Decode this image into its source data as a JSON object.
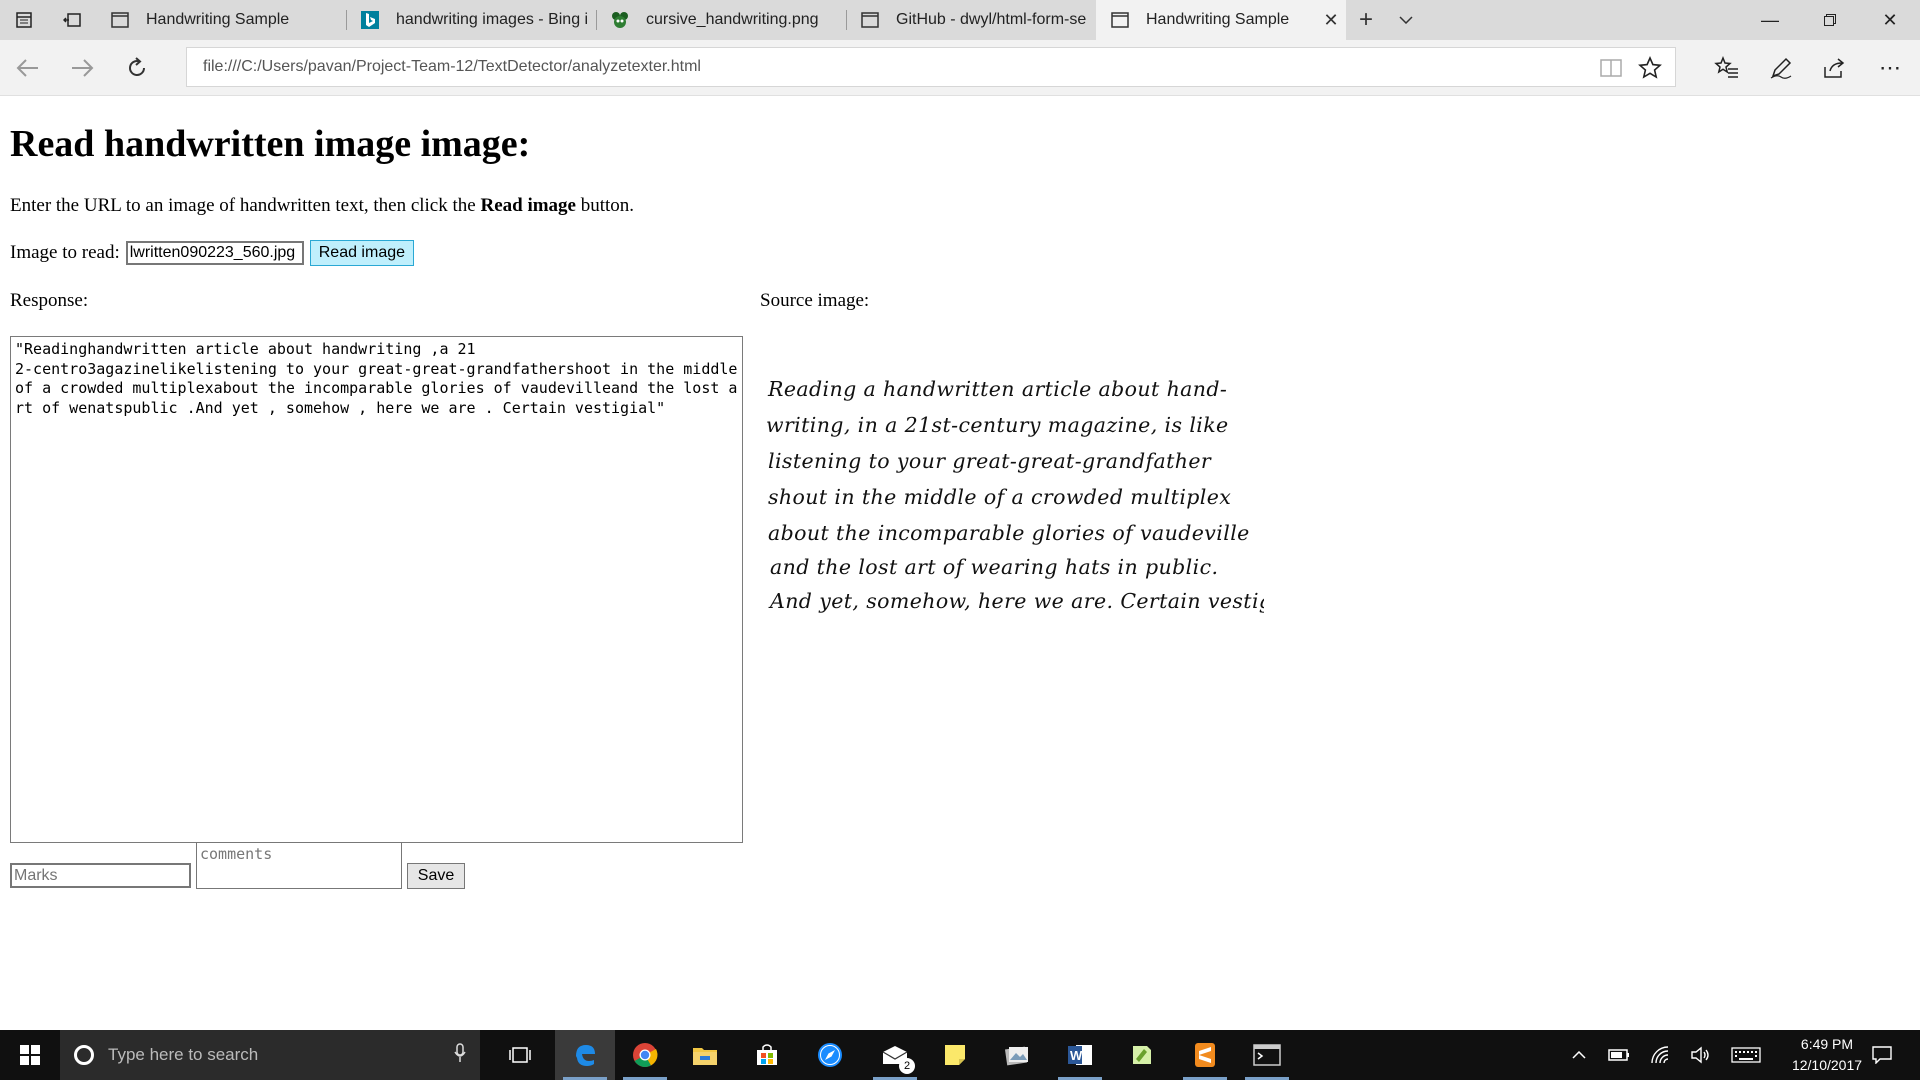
{
  "browser": {
    "tabs": [
      {
        "title": "Handwriting Sample",
        "icon": "page-icon",
        "active": false
      },
      {
        "title": "handwriting images - Bing i",
        "icon": "bing-icon",
        "active": false
      },
      {
        "title": "cursive_handwriting.png",
        "icon": "image-icon",
        "active": false
      },
      {
        "title": "GitHub - dwyl/html-form-se",
        "icon": "page-icon",
        "active": false
      },
      {
        "title": "Handwriting Sample",
        "icon": "page-icon",
        "active": true
      }
    ],
    "url": "file:///C:/Users/pavan/Project-Team-12/TextDetector/analyzetexter.html"
  },
  "page": {
    "heading": "Read handwritten image image:",
    "instructions_prefix": "Enter the URL to an image of handwritten text, then click the ",
    "instructions_bold": "Read image",
    "instructions_suffix": " button.",
    "image_label": "Image to read: ",
    "image_url_value": "lwritten090223_560.jpg",
    "read_button": "Read image",
    "response_label": "Response:",
    "source_label": "Source image:",
    "response_text": "\"Readinghandwritten article about handwriting ,a 21\n2-centro3agazinelikelistening to your great-great-grandfathershoot in the middle of a crowded multiplexabout the incomparable glories of vaudevilleand the lost art of wenatspublic .And yet , somehow , here we are . Certain vestigial\"",
    "handwriting_lines": [
      "Reading a handwritten article about hand-",
      "writing, in a 21st-century magazine, is like",
      "listening to your great-great-grandfather",
      "shout in the middle of a crowded multiplex",
      "about the incomparable glories of vaudeville",
      "and the lost art of wearing hats in public.",
      "And yet, somehow, here we are. Certain vestigial"
    ],
    "marks_placeholder": "Marks",
    "comments_placeholder": "comments",
    "save_button": "Save"
  },
  "taskbar": {
    "search_placeholder": "Type here to search",
    "mail_badge": "2",
    "time": "6:49 PM",
    "date": "12/10/2017"
  }
}
